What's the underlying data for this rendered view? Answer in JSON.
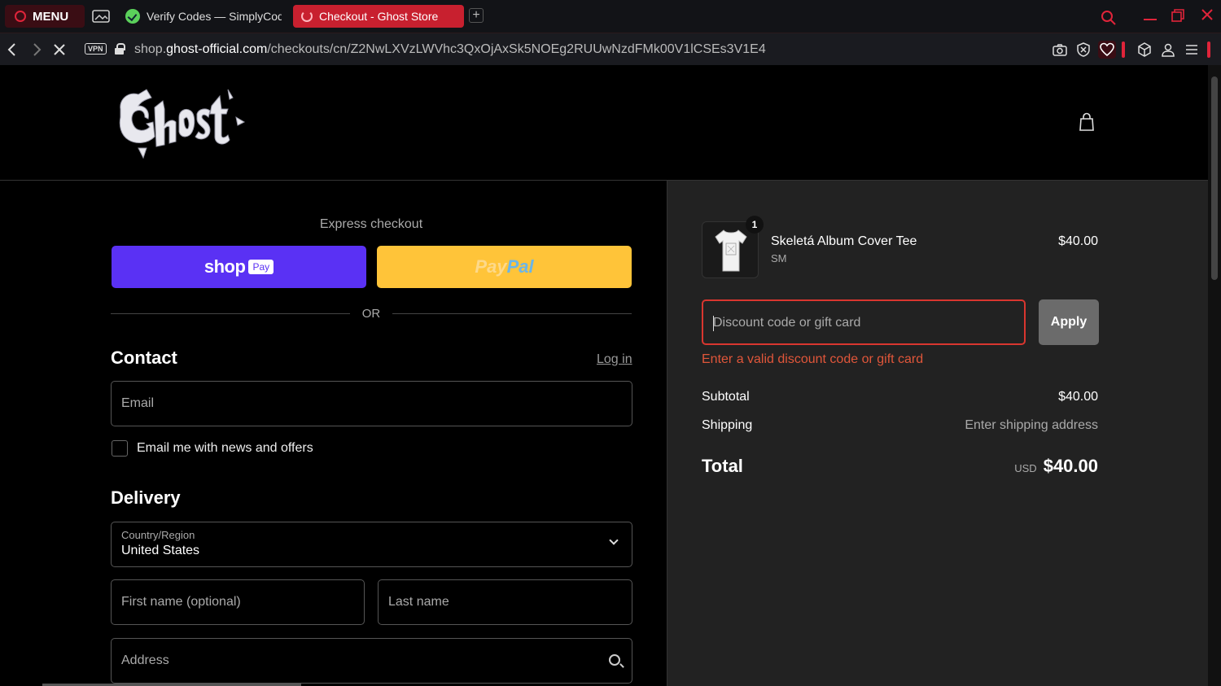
{
  "browser": {
    "menu_label": "MENU",
    "tabs": [
      {
        "title": "Verify Codes — SimplyCodes"
      },
      {
        "title": "Checkout - Ghost Store"
      }
    ],
    "new_tab_symbol": "+",
    "url_domain_prefix": "shop.",
    "url_domain": "ghost-official.com",
    "url_path": "/checkouts/cn/Z2NwLXVzLWVhc3QxOjAxSk5NOEg2RUUwNzdFMk00V1lCSEs3V1E4",
    "vpn_label": "VPN",
    "accent_color": "#e0243a"
  },
  "express": {
    "title": "Express checkout",
    "shop_label": "shop",
    "shop_pay_badge": "Pay",
    "paypal_part1": "Pay",
    "paypal_part2": "Pal",
    "or_label": "OR"
  },
  "contact": {
    "title": "Contact",
    "login_label": "Log in",
    "email_placeholder": "Email",
    "newsletter_label": "Email me with news and offers"
  },
  "delivery": {
    "title": "Delivery",
    "country_label": "Country/Region",
    "country_value": "United States",
    "first_name_placeholder": "First name (optional)",
    "last_name_placeholder": "Last name",
    "address_placeholder": "Address"
  },
  "summary": {
    "item": {
      "name": "Skeletá Album Cover Tee",
      "variant": "SM",
      "price": "$40.00",
      "quantity": "1"
    },
    "discount_placeholder": "Discount code or gift card",
    "apply_label": "Apply",
    "discount_error": "Enter a valid discount code or gift card",
    "subtotal_label": "Subtotal",
    "subtotal_value": "$40.00",
    "shipping_label": "Shipping",
    "shipping_value": "Enter shipping address",
    "total_label": "Total",
    "total_currency": "USD",
    "total_value": "$40.00",
    "error_color": "#e0563a"
  }
}
